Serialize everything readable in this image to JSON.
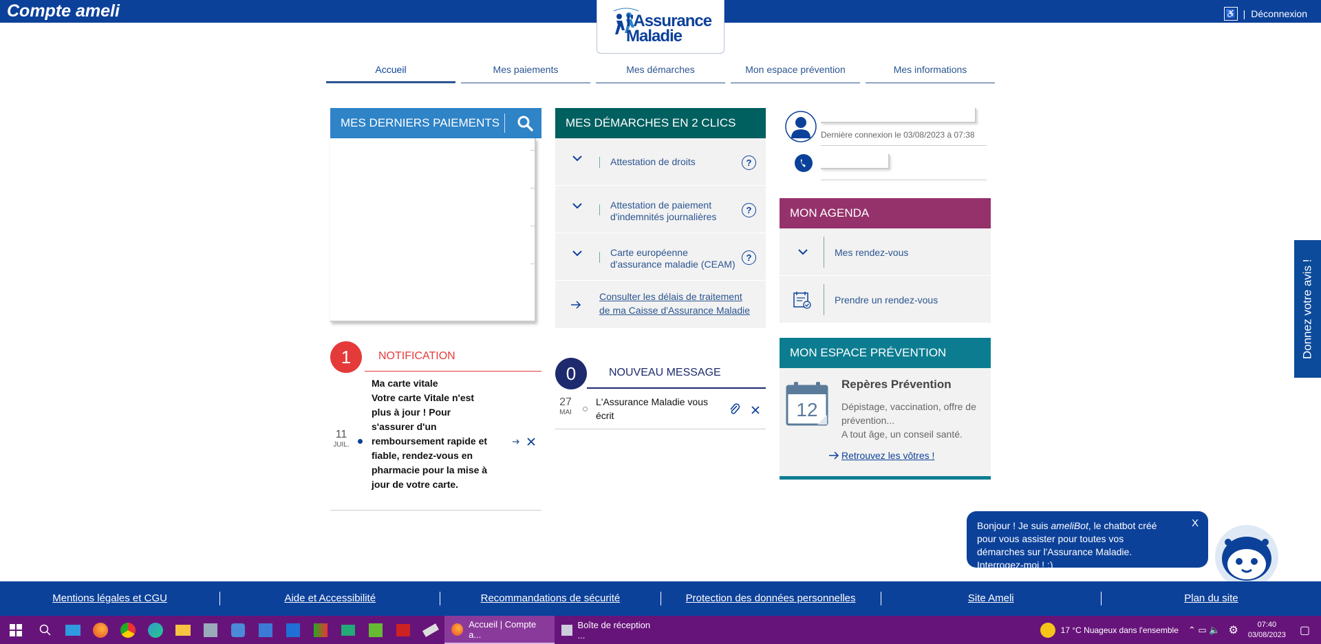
{
  "header": {
    "brand": "Compte ameli",
    "logo_line1": "l'Assurance",
    "logo_line2": "Maladie",
    "logout": "Déconnexion"
  },
  "nav": {
    "tabs": [
      "Accueil",
      "Mes paiements",
      "Mes démarches",
      "Mon espace prévention",
      "Mes informations"
    ],
    "active": "Accueil"
  },
  "payments": {
    "title": "MES DERNIERS PAIEMENTS"
  },
  "notification": {
    "count": "1",
    "title": "NOTIFICATION",
    "day": "11",
    "month": "JUIL.",
    "heading": "Ma carte vitale",
    "body": "Votre carte Vitale n'est plus à jour ! Pour s'assurer d'un remboursement rapide et fiable, rendez-vous en pharmacie pour la mise à jour de votre carte."
  },
  "demarches": {
    "title": "MES DÉMARCHES EN 2 CLICS",
    "items": [
      {
        "label": "Attestation de droits"
      },
      {
        "label": "Attestation de paiement d'indemnités journalières"
      },
      {
        "label": "Carte européenne d'assurance maladie (CEAM)"
      }
    ],
    "link": "Consulter les délais de traitement de ma Caisse d'Assurance Maladie"
  },
  "messages": {
    "count": "0",
    "title": "NOUVEAU MESSAGE",
    "day": "27",
    "month": "MAI",
    "text": "L'Assurance Maladie vous écrit"
  },
  "profile": {
    "last_login": "Dernière connexion le 03/08/2023 à 07:38"
  },
  "agenda": {
    "title": "MON AGENDA",
    "items": [
      "Mes rendez-vous",
      "Prendre un rendez-vous"
    ]
  },
  "prevention": {
    "title": "MON ESPACE PRÉVENTION",
    "calendar_day": "12",
    "heading": "Repères Prévention",
    "line1": "Dépistage, vaccination, offre de prévention...",
    "line2": "A tout âge, un conseil santé.",
    "link": "Retrouvez les vôtres !"
  },
  "feedback": "Donnez votre avis !",
  "chatbot": {
    "text_before": "Bonjour ! Je suis ",
    "name": "ameliBot",
    "text_after": ", le chatbot créé pour vous assister pour toutes vos démarches sur l'Assurance Maladie. Interrogez-moi ! :)",
    "close": "X"
  },
  "footer": {
    "links": [
      "Mentions légales et CGU",
      "Aide et Accessibilité",
      "Recommandations de sécurité",
      "Protection des données personnelles",
      "Site Ameli",
      "Plan du site"
    ]
  },
  "taskbar": {
    "apps": [
      "Accueil | Compte a...",
      "Boîte de réception ..."
    ],
    "weather": "17 °C  Nuageux dans l'ensemble",
    "time": "07:40",
    "date": "03/08/2023"
  },
  "colors": {
    "header_blue": "#0c419a",
    "payments_blue": "#2f83c7",
    "demarches_teal": "#005f5f",
    "agenda_purple": "#95316b",
    "prevention_teal": "#0c7d91",
    "notif_red": "#e53a3a",
    "message_navy": "#1e2a6e",
    "taskbar_purple": "#67147a"
  }
}
